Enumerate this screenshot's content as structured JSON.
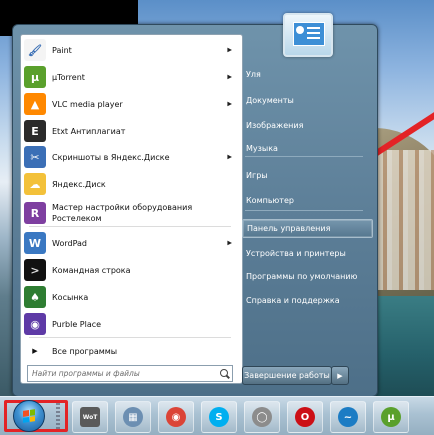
{
  "start_menu": {
    "programs": [
      {
        "label": "Paint",
        "icon": "paint-icon",
        "has_submenu": true
      },
      {
        "label": "µTorrent",
        "icon": "utorrent-icon",
        "has_submenu": true
      },
      {
        "label": "VLC media player",
        "icon": "vlc-icon",
        "has_submenu": true
      },
      {
        "label": "Etxt Антиплагиат",
        "icon": "etxt-icon",
        "has_submenu": false
      },
      {
        "label": "Скриншоты в Яндекс.Диске",
        "icon": "yandex-screenshot-icon",
        "has_submenu": true
      },
      {
        "label": "Яндекс.Диск",
        "icon": "yandex-disk-icon",
        "has_submenu": false
      },
      {
        "label": "Мастер настройки оборудования",
        "label_line2": "Ростелеком",
        "icon": "rostelecom-icon",
        "has_submenu": false
      },
      {
        "label": "WordPad",
        "icon": "wordpad-icon",
        "has_submenu": true
      },
      {
        "label": "Командная строка",
        "icon": "cmd-icon",
        "has_submenu": false
      },
      {
        "label": "Косынка",
        "icon": "solitaire-icon",
        "has_submenu": false
      },
      {
        "label": "Purble Place",
        "icon": "purble-place-icon",
        "has_submenu": false
      }
    ],
    "all_programs": "Все программы",
    "search_placeholder": "Найти программы и файлы",
    "right_items": [
      {
        "label": "Уля"
      },
      {
        "label": "Документы"
      },
      {
        "label": "Изображения"
      },
      {
        "label": "Музыка"
      },
      {
        "label": "Игры"
      },
      {
        "label": "Компьютер"
      },
      {
        "label": "Панель управления",
        "highlighted": true
      },
      {
        "label": "Устройства и принтеры"
      },
      {
        "label": "Программы по умолчанию"
      },
      {
        "label": "Справка и поддержка"
      }
    ],
    "shutdown_label": "Завершение работы",
    "shutdown_arrow": "▶"
  },
  "taskbar": {
    "start_button": "windows-start-orb",
    "pinned": [
      {
        "name": "world-of-tanks-icon",
        "color": "#5a5a5a",
        "glyph": "WoT"
      },
      {
        "name": "calculator-icon",
        "color": "#6c8fb2",
        "glyph": "▦"
      },
      {
        "name": "chrome-icon",
        "color": "#db4437",
        "glyph": "◉"
      },
      {
        "name": "skype-icon",
        "color": "#00aff0",
        "glyph": "S"
      },
      {
        "name": "mouse-app-icon",
        "color": "#8c8c8c",
        "glyph": "◯"
      },
      {
        "name": "opera-icon",
        "color": "#cc0f16",
        "glyph": "O"
      },
      {
        "name": "bird-app-icon",
        "color": "#1c7cc4",
        "glyph": "~"
      },
      {
        "name": "utorrent-taskbar-icon",
        "color": "#5aa02c",
        "glyph": "µ"
      }
    ]
  },
  "colors": {
    "highlight_frame": "#e32326",
    "menu_blue": "#5d7f98"
  }
}
